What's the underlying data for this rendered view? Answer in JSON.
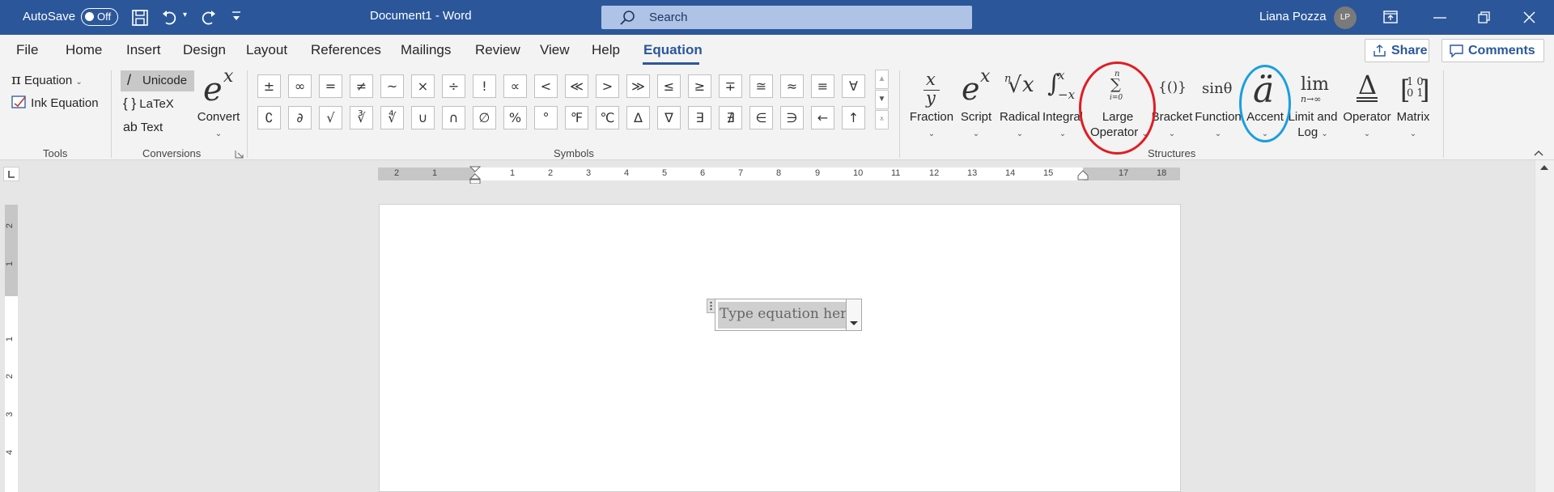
{
  "titlebar": {
    "autosave_label": "AutoSave",
    "autosave_state": "Off",
    "doc_title": "Document1  -  Word",
    "search_placeholder": "Search",
    "user_name": "Liana Pozza",
    "user_initials": "LP"
  },
  "menu": {
    "items": [
      "File",
      "Home",
      "Insert",
      "Design",
      "Layout",
      "References",
      "Mailings",
      "Review",
      "View",
      "Help",
      "Equation"
    ],
    "active": "Equation",
    "share_label": "Share",
    "comments_label": "Comments"
  },
  "tools": {
    "equation_label": "Equation",
    "ink_equation_label": "Ink Equation",
    "group_label": "Tools"
  },
  "conversions": {
    "unicode_label": "Unicode",
    "latex_label": "LaTeX",
    "text_label": "Text",
    "convert_label": "Convert",
    "group_label": "Conversions"
  },
  "symbols": {
    "row1": [
      "±",
      "∞",
      "=",
      "≠",
      "~",
      "×",
      "÷",
      "!",
      "∝",
      "<",
      "≪",
      ">",
      "≫",
      "≤",
      "≥",
      "∓",
      "≅",
      "≈",
      "≡",
      "∀"
    ],
    "row2": [
      "∁",
      "∂",
      "√",
      "∛",
      "∜",
      "∪",
      "∩",
      "∅",
      "%",
      "°",
      "℉",
      "℃",
      "∆",
      "∇",
      "∃",
      "∄",
      "∈",
      "∋",
      "←",
      "↑"
    ],
    "group_label": "Symbols"
  },
  "structures": {
    "group_label": "Structures",
    "items": [
      {
        "label": "Fraction"
      },
      {
        "label": "Script"
      },
      {
        "label": "Radical"
      },
      {
        "label": "Integral"
      },
      {
        "label1": "Large",
        "label2": "Operator"
      },
      {
        "label": "Bracket"
      },
      {
        "label": "Function"
      },
      {
        "label": "Accent"
      },
      {
        "label1": "Limit and",
        "label2": "Log"
      },
      {
        "label": "Operator"
      },
      {
        "label": "Matrix"
      }
    ]
  },
  "ruler": {
    "h_numbers": [
      "2",
      "1",
      "1",
      "2",
      "3",
      "4",
      "5",
      "6",
      "7",
      "8",
      "9",
      "10",
      "11",
      "12",
      "13",
      "14",
      "15",
      "17",
      "18"
    ],
    "v_numbers": [
      "2",
      "1",
      "1",
      "2",
      "3",
      "4"
    ]
  },
  "document": {
    "equation_placeholder": "Type equation here."
  },
  "colors": {
    "word_blue": "#2b579a",
    "annotation_red": "#e11c24",
    "annotation_blue": "#1a9ee0"
  }
}
